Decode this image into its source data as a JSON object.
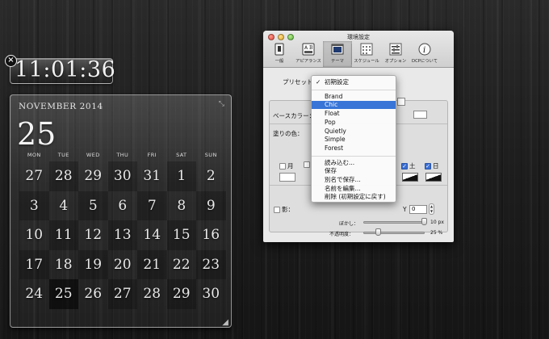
{
  "clock": {
    "time": "11:01:36",
    "close_label": "×"
  },
  "calendar": {
    "month_label": "NOVEMBER 2014",
    "big_day": "25",
    "resize_glyph_top": "⤡",
    "resize_glyph_bottom": "◢",
    "weekdays": [
      "MON",
      "TUE",
      "WED",
      "THU",
      "FRI",
      "SAT",
      "SUN"
    ],
    "days": [
      [
        "27",
        "28",
        "29",
        "30",
        "31",
        "1",
        "2"
      ],
      [
        "3",
        "4",
        "5",
        "6",
        "7",
        "8",
        "9"
      ],
      [
        "10",
        "11",
        "12",
        "13",
        "14",
        "15",
        "16"
      ],
      [
        "17",
        "18",
        "19",
        "20",
        "21",
        "22",
        "23"
      ],
      [
        "24",
        "25",
        "26",
        "27",
        "28",
        "29",
        "30"
      ]
    ],
    "today_index": 29
  },
  "prefs": {
    "title": "環境設定",
    "toolbar": [
      {
        "label": "一般",
        "icon": "switch-icon"
      },
      {
        "label": "アピアランス",
        "icon": "appearance-icon"
      },
      {
        "label": "テーマ",
        "icon": "theme-icon",
        "selected": true
      },
      {
        "label": "スケジュール",
        "icon": "schedule-icon"
      },
      {
        "label": "オプション",
        "icon": "options-icon"
      },
      {
        "label": "DCPについて",
        "icon": "info-icon"
      }
    ],
    "preset_label": "プリセット：",
    "base_color_label": "ベースカラー：",
    "fill_color_label": "塗りの色：",
    "day_mon": "月",
    "day_sat": "土",
    "day_sun": "日",
    "shadow_label": "影：",
    "y_label": "Y",
    "y_value": "0",
    "blur_label": "ぼかし：",
    "blur_value": "10 px",
    "opacity_label": "不透明度：",
    "opacity_value": "25 %",
    "blur_level": 1.0,
    "opacity_level": 0.25
  },
  "menu": {
    "checked_item": "初期設定",
    "themes": [
      "Brand",
      "Chic",
      "Float",
      "Pop",
      "Quietly",
      "Simple",
      "Forest"
    ],
    "highlighted": "Chic",
    "actions": [
      "読み込む...",
      "保存",
      "別名で保存...",
      "名前を編集...",
      "削除 (初期設定に戻す)"
    ]
  },
  "colors": {
    "highlight": "#3875d7",
    "checkbox_on": "#3a6fd6"
  }
}
